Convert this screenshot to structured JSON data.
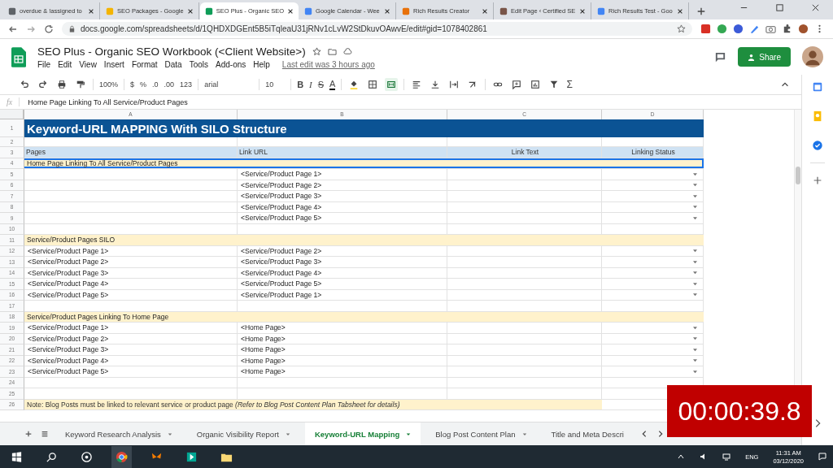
{
  "browser": {
    "tabs": [
      {
        "title": "overdue & !assigned to",
        "selected": false
      },
      {
        "title": "SEO Packages - Google",
        "selected": false
      },
      {
        "title": "SEO Plus - Organic SEO",
        "selected": true
      },
      {
        "title": "Google Calendar - Wee",
        "selected": false
      },
      {
        "title": "Rich Results Creator",
        "selected": false
      },
      {
        "title": "Edit Page ‹ Certified SE",
        "selected": false
      },
      {
        "title": "Rich Results Test - Goo",
        "selected": false
      }
    ],
    "url": "docs.google.com/spreadsheets/d/1QHDXDGEnt5B5iTqleaU31jRNv1cLvW2StDkuvOAwvE/edit#gid=1078402861"
  },
  "doc": {
    "title": "SEO Plus  - Organic SEO Workbook (<Client Website>)",
    "menu": [
      "File",
      "Edit",
      "View",
      "Insert",
      "Format",
      "Data",
      "Tools",
      "Add-ons",
      "Help"
    ],
    "last_edit": "Last edit was 3 hours ago",
    "share": "Share"
  },
  "toolbar": {
    "zoom": "100%",
    "currency": "$",
    "percent": "%",
    "dec_less": ".0",
    "dec_more": ".00",
    "number_format": "123",
    "font": "arial",
    "font_size": "10",
    "bold": "B",
    "italic": "I",
    "strike": "S",
    "text_color": "A",
    "functions": "Σ",
    "merge_active": true
  },
  "formula_bar": {
    "fx": "fx",
    "value": "Home Page Linking To All Service/Product Pages"
  },
  "sheet": {
    "columns": [
      "A",
      "B",
      "C",
      "D"
    ],
    "rows": [
      {
        "num": "1",
        "kind": "title",
        "text": "Keyword-URL MAPPING With SILO Structure",
        "selected": false,
        "dropdown": false
      },
      {
        "num": "2",
        "kind": "blank",
        "selected": false,
        "dropdown": false
      },
      {
        "num": "3",
        "kind": "header",
        "cells": [
          "Pages",
          "Link URL",
          "Link Text",
          "Linking Status"
        ],
        "selected": false,
        "dropdown": false
      },
      {
        "num": "4",
        "kind": "section",
        "text": "Home Page Linking To All Service/Product Pages",
        "selected": true,
        "dropdown": false
      },
      {
        "num": "5",
        "kind": "data",
        "link_url": "<Service/Product Page 1>",
        "selected": false,
        "dropdown": true
      },
      {
        "num": "6",
        "kind": "data",
        "link_url": "<Service/Product Page 2>",
        "selected": false,
        "dropdown": true
      },
      {
        "num": "7",
        "kind": "data",
        "link_url": "<Service/Product Page 3>",
        "selected": false,
        "dropdown": true
      },
      {
        "num": "8",
        "kind": "data",
        "link_url": "<Service/Product Page 4>",
        "selected": false,
        "dropdown": true
      },
      {
        "num": "9",
        "kind": "data",
        "link_url": "<Service/Product Page 5>",
        "selected": false,
        "dropdown": true
      },
      {
        "num": "10",
        "kind": "blank",
        "selected": false,
        "dropdown": false
      },
      {
        "num": "11",
        "kind": "section",
        "text": "Service/Product Pages SILO",
        "selected": false,
        "dropdown": false
      },
      {
        "num": "12",
        "kind": "data",
        "page": "<Service/Product Page 1>",
        "link_url": "<Service/Product Page 2>",
        "selected": false,
        "dropdown": true
      },
      {
        "num": "13",
        "kind": "data",
        "page": "<Service/Product Page 2>",
        "link_url": "<Service/Product Page 3>",
        "selected": false,
        "dropdown": true
      },
      {
        "num": "14",
        "kind": "data",
        "page": "<Service/Product Page 3>",
        "link_url": "<Service/Product Page 4>",
        "selected": false,
        "dropdown": true
      },
      {
        "num": "15",
        "kind": "data",
        "page": "<Service/Product Page 4>",
        "link_url": "<Service/Product Page 5>",
        "selected": false,
        "dropdown": true
      },
      {
        "num": "16",
        "kind": "data",
        "page": "<Service/Product Page 5>",
        "link_url": "<Service/Product Page 1>",
        "selected": false,
        "dropdown": true
      },
      {
        "num": "17",
        "kind": "blank",
        "selected": false,
        "dropdown": false
      },
      {
        "num": "18",
        "kind": "section",
        "text": "Service/Product Pages Linking To Home Page",
        "selected": false,
        "dropdown": false
      },
      {
        "num": "19",
        "kind": "data",
        "page": "<Service/Product Page 1>",
        "link_url": "<Home Page>",
        "selected": false,
        "dropdown": true
      },
      {
        "num": "20",
        "kind": "data",
        "page": "<Service/Product Page 2>",
        "link_url": "<Home Page>",
        "selected": false,
        "dropdown": true
      },
      {
        "num": "21",
        "kind": "data",
        "page": "<Service/Product Page 3>",
        "link_url": "<Home Page>",
        "selected": false,
        "dropdown": true
      },
      {
        "num": "22",
        "kind": "data",
        "page": "<Service/Product Page 4>",
        "link_url": "<Home Page>",
        "selected": false,
        "dropdown": true
      },
      {
        "num": "23",
        "kind": "data",
        "page": "<Service/Product Page 5>",
        "link_url": "<Home Page>",
        "selected": false,
        "dropdown": true
      },
      {
        "num": "24",
        "kind": "blank",
        "selected": false,
        "dropdown": false
      },
      {
        "num": "25",
        "kind": "blank",
        "selected": false,
        "dropdown": false
      },
      {
        "num": "26",
        "kind": "note",
        "text": "Note:  Blog Posts must be linked to relevant service or product page *(Refer to Blog Post Content Plan Tabsheet for details)*",
        "selected": false,
        "dropdown": false
      }
    ]
  },
  "sheet_tabs": [
    {
      "label": "Keyword Research Analysis",
      "selected": false,
      "caret": true
    },
    {
      "label": "Organic Visibility Report",
      "selected": false,
      "caret": true
    },
    {
      "label": "Keyword-URL Mapping",
      "selected": true,
      "caret": true
    },
    {
      "label": "Blog Post Content Plan",
      "selected": false,
      "caret": true
    },
    {
      "label": "Title and Meta Descri",
      "selected": false,
      "caret": false
    }
  ],
  "timer": "00:00:39.8",
  "taskbar": {
    "language": "ENG",
    "time": "11:31 AM",
    "date": "03/12/2020"
  }
}
